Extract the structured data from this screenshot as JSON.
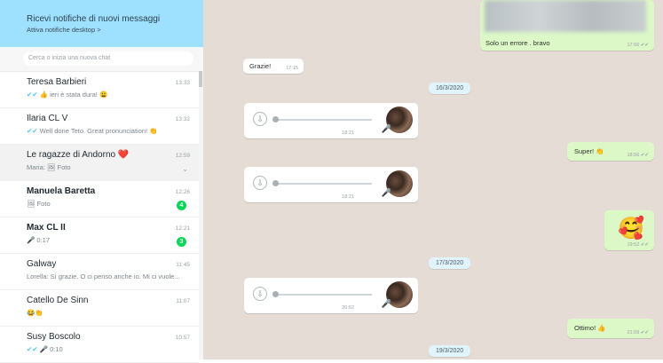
{
  "sidebar": {
    "notification": {
      "title": "Ricevi notifiche di nuovi messaggi",
      "link": "Attiva notifiche desktop >"
    },
    "search": {
      "placeholder": "Cerca o inizia una nuova chat"
    },
    "chats": [
      {
        "name": "Teresa Barbieri",
        "preview": "👍 ieri è stata dura! 😩",
        "ticks": "✔✔",
        "time": "13:33",
        "bold": false
      },
      {
        "name": "Ilaria CL V",
        "preview": "Well done Teto. Great pronunciation! 👏",
        "ticks": "✔✔",
        "time": "13:32",
        "bold": false
      },
      {
        "name": "Le ragazze di Andorno ❤️",
        "preview": "Maria: 🖼 Foto",
        "time": "12:59",
        "bold": false,
        "active": true
      },
      {
        "name": "Manuela Baretta",
        "preview": "🖼 Foto",
        "time": "12:26",
        "unread": "4",
        "bold": true
      },
      {
        "name": "Max CL II",
        "preview": "🎤 0:17",
        "time": "12:21",
        "unread": "3",
        "bold": true
      },
      {
        "name": "Galway",
        "preview": "Lorella: Sì grazie. O ci penso anche io. Mi ci vuole...",
        "time": "11:45",
        "bold": false
      },
      {
        "name": "Catello De Sinn",
        "preview": "😂👏",
        "time": "11:07",
        "bold": false
      },
      {
        "name": "Susy Boscolo",
        "preview": "🎤 0:10",
        "ticks": "✔✔",
        "time": "10:57",
        "bold": false
      }
    ]
  },
  "conversation": {
    "messages": [
      {
        "type": "out-text",
        "text": "Solo un errore . bravo",
        "time": "17:06 ✔✔"
      },
      {
        "type": "in-text",
        "text": "Grazie!",
        "time": "17:15"
      },
      {
        "type": "date",
        "text": "16/3/2020"
      },
      {
        "type": "in-audio",
        "time": "18:21"
      },
      {
        "type": "out-text",
        "text": "Super! 👏",
        "time": "18:56 ✔✔"
      },
      {
        "type": "in-audio",
        "time": "18:21"
      },
      {
        "type": "out-emoji",
        "text": "🥰",
        "time": "19:52 ✔✔"
      },
      {
        "type": "date",
        "text": "17/3/2020"
      },
      {
        "type": "in-audio",
        "time": "20:52"
      },
      {
        "type": "out-text",
        "text": "Ottimo! 👍",
        "time": "21:09 ✔✔"
      },
      {
        "type": "date",
        "text": "19/3/2020"
      }
    ]
  },
  "icons": {
    "download": "⇩",
    "mic": "🎤",
    "chevron": "⌄"
  },
  "colors": {
    "notification_bg": "#9de1fe",
    "chat_bg": "#e5ddd5",
    "outgoing_bubble": "#dcf8c6",
    "unread_badge": "#06d755",
    "date_chip": "#e1f3fb"
  }
}
